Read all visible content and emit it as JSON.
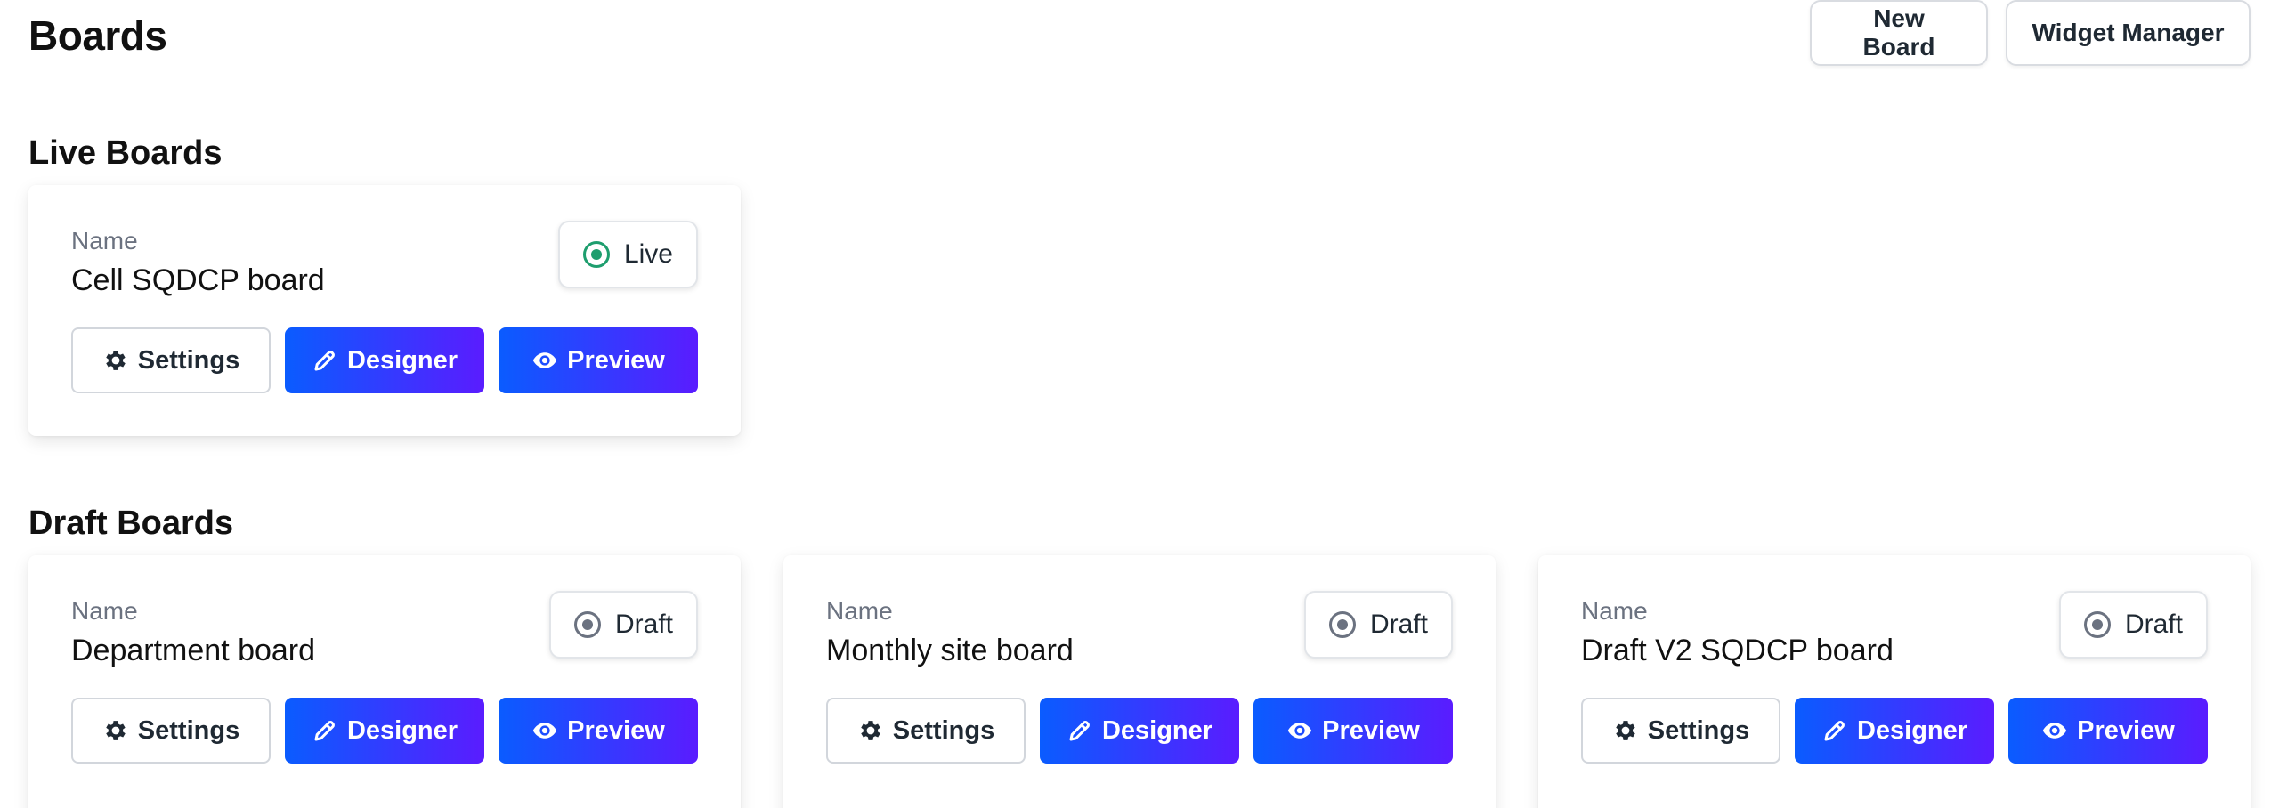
{
  "header": {
    "title": "Boards",
    "new_board_label": "New Board",
    "widget_manager_label": "Widget Manager"
  },
  "sections": {
    "live": {
      "title": "Live Boards",
      "boards": [
        {
          "name_label": "Name",
          "name": "Cell SQDCP board",
          "status": "Live",
          "settings_label": "Settings",
          "designer_label": "Designer",
          "preview_label": "Preview"
        }
      ]
    },
    "draft": {
      "title": "Draft Boards",
      "boards": [
        {
          "name_label": "Name",
          "name": "Department board",
          "status": "Draft",
          "settings_label": "Settings",
          "designer_label": "Designer",
          "preview_label": "Preview"
        },
        {
          "name_label": "Name",
          "name": "Monthly site board",
          "status": "Draft",
          "settings_label": "Settings",
          "designer_label": "Designer",
          "preview_label": "Preview"
        },
        {
          "name_label": "Name",
          "name": "Draft V2 SQDCP board",
          "status": "Draft",
          "settings_label": "Settings",
          "designer_label": "Designer",
          "preview_label": "Preview"
        }
      ]
    }
  },
  "colors": {
    "live_status": "#1e9e6e",
    "draft_status": "#6b7280",
    "gradient_start": "#0a5cff",
    "gradient_end": "#5a1cff"
  },
  "icons": {
    "settings": "gear-icon",
    "designer": "pencil-icon",
    "preview": "eye-icon",
    "status": "radio-dot-icon"
  }
}
